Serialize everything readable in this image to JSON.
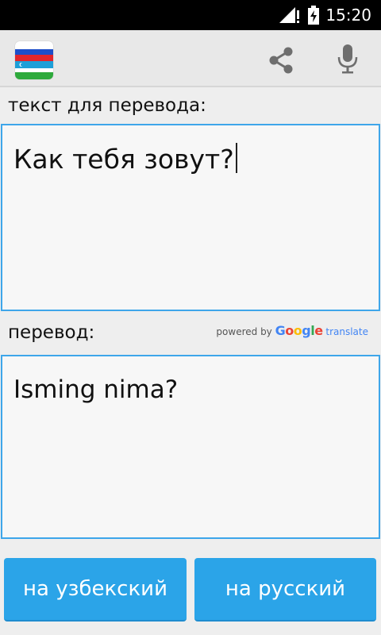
{
  "status_bar": {
    "time": "15:20",
    "icons": [
      "signal-icon",
      "battery-charging-icon"
    ]
  },
  "app_bar": {
    "icons": [
      "flag-ru-uz-icon",
      "share-icon",
      "mic-icon"
    ]
  },
  "source": {
    "label": "текст для перевода:",
    "text": "Как тебя зовут?"
  },
  "translation": {
    "label": "перевод:",
    "powered_by": "powered by",
    "google": [
      "G",
      "o",
      "o",
      "g",
      "l",
      "e"
    ],
    "translate": "translate",
    "text": "Isming nima?"
  },
  "buttons": {
    "to_uzbek": "на узбекский",
    "to_russian": "на русский"
  },
  "colors": {
    "accent": "#2ba4e8",
    "border": "#3ea6ea",
    "google": [
      "#4285f4",
      "#ea4335",
      "#fbbc05",
      "#4285f4",
      "#34a853",
      "#ea4335"
    ]
  }
}
